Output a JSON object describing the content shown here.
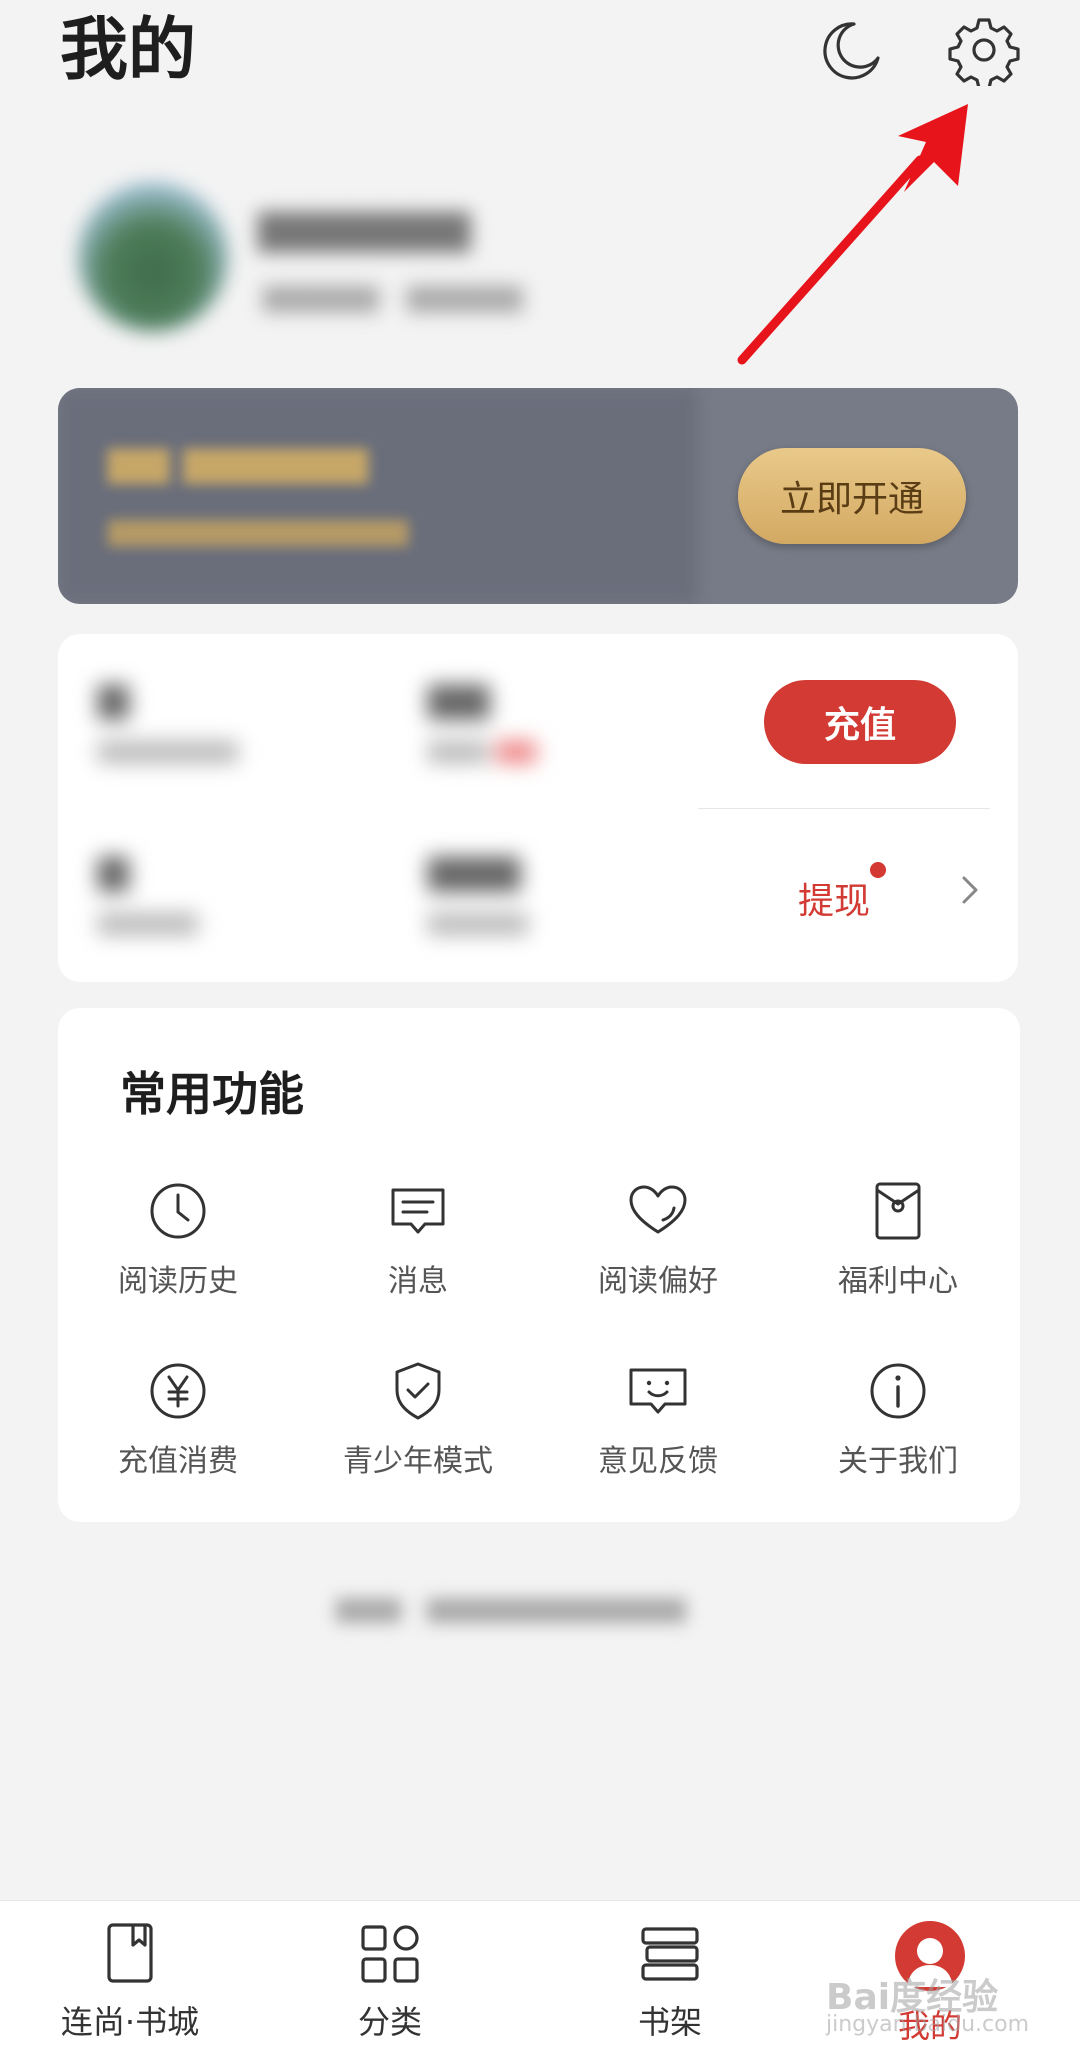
{
  "header": {
    "title": "我的",
    "icons": [
      "moon-icon",
      "gear-icon"
    ]
  },
  "vip": {
    "button_label": "立即开通"
  },
  "wallet": {
    "recharge_label": "充值",
    "withdraw_label": "提现"
  },
  "functions": {
    "title": "常用功能",
    "items": [
      {
        "label": "阅读历史",
        "icon": "clock-icon"
      },
      {
        "label": "消息",
        "icon": "message-icon"
      },
      {
        "label": "阅读偏好",
        "icon": "heart-icon"
      },
      {
        "label": "福利中心",
        "icon": "red-envelope-icon"
      },
      {
        "label": "充值消费",
        "icon": "yuan-icon"
      },
      {
        "label": "青少年模式",
        "icon": "shield-check-icon"
      },
      {
        "label": "意见反馈",
        "icon": "feedback-icon"
      },
      {
        "label": "关于我们",
        "icon": "info-icon"
      }
    ]
  },
  "bottom_nav": {
    "items": [
      {
        "label": "连尚·书城",
        "icon": "book-icon"
      },
      {
        "label": "分类",
        "icon": "grid-icon"
      },
      {
        "label": "书架",
        "icon": "bookshelf-icon"
      },
      {
        "label": "我的",
        "icon": "avatar-icon",
        "active": true
      }
    ]
  },
  "watermark": {
    "brand": "Bai度经验",
    "url": "jingyan.baidu.com"
  },
  "colors": {
    "accent_red": "#d23a33",
    "vip_gold": "#d9b06a",
    "vip_card_bg": "#777b87",
    "background": "#f3f3f3"
  }
}
